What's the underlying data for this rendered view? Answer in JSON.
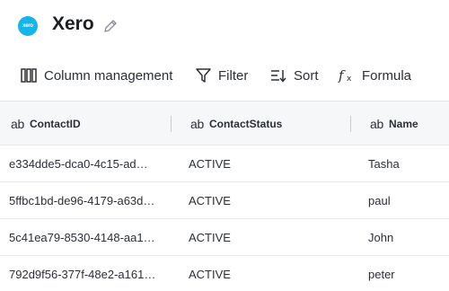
{
  "app": {
    "title": "Xero",
    "logo_text": "xero",
    "brand_color": "#13b5ea"
  },
  "toolbar": {
    "column_management": "Column management",
    "filter": "Filter",
    "sort": "Sort",
    "formula": "Formula"
  },
  "table": {
    "type_prefix": "ab",
    "columns": [
      "ContactID",
      "ContactStatus",
      "Name"
    ],
    "rows": [
      {
        "id": "e334dde5-dca0-4c15-ad…",
        "status": "ACTIVE",
        "name": "Tasha"
      },
      {
        "id": "5ffbc1bd-de96-4179-a63d…",
        "status": "ACTIVE",
        "name": "paul"
      },
      {
        "id": "5c41ea79-8530-4148-aa1…",
        "status": "ACTIVE",
        "name": "John"
      },
      {
        "id": "792d9f56-377f-48e2-a161…",
        "status": "ACTIVE",
        "name": "peter"
      }
    ]
  }
}
